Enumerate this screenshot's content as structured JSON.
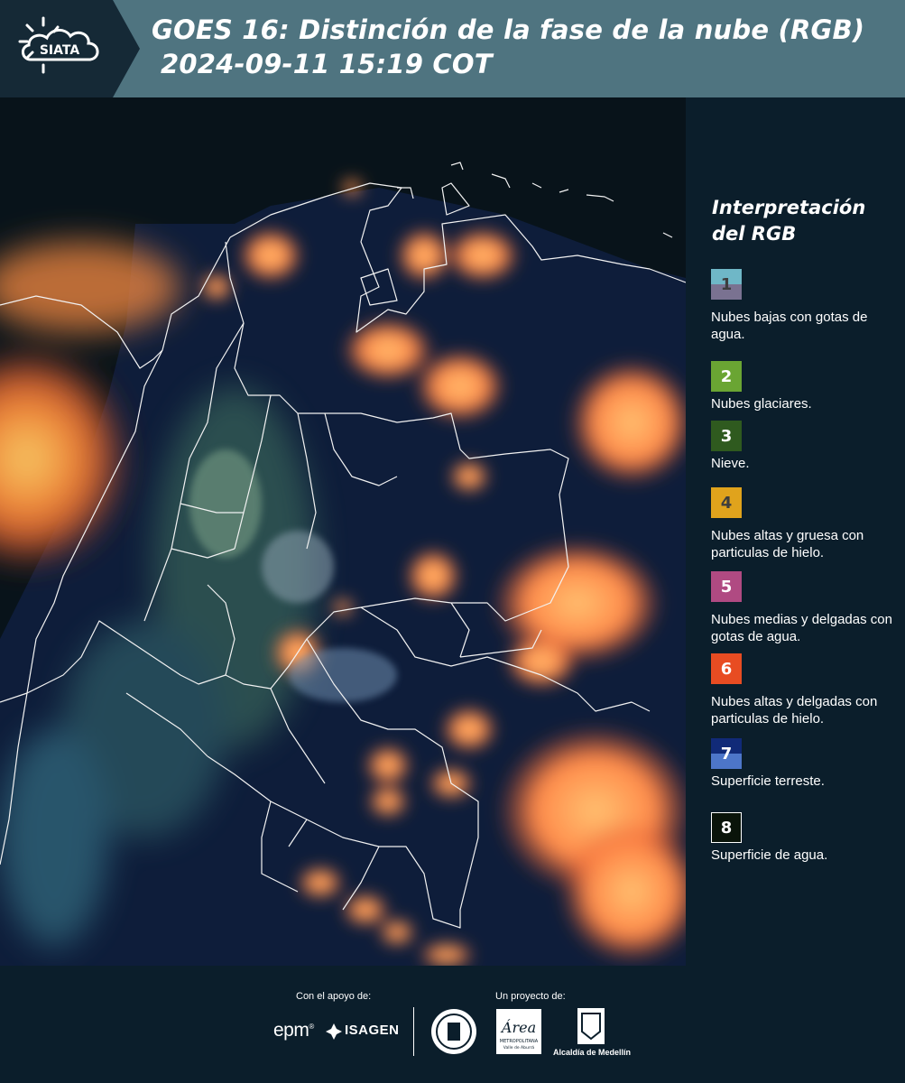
{
  "header": {
    "logo_text": "SIATA",
    "title_line1": "GOES 16: Distinción de la fase de la nube (RGB)",
    "title_line2": "2024-09-11 15:19 COT",
    "bg_color": "#4f7480"
  },
  "legend": {
    "title": "Interpretación del RGB",
    "items": [
      {
        "number": "1",
        "label": "Nubes bajas con gotas de agua.",
        "color_top": "#6fb7c7",
        "color_bottom": "#7a7291"
      },
      {
        "number": "2",
        "label": "Nubes glaciares.",
        "color": "#6aa533"
      },
      {
        "number": "3",
        "label": "Nieve.",
        "color": "#2f5a1f"
      },
      {
        "number": "4",
        "label": "Nubes altas y gruesa con particulas de hielo.",
        "color": "#e0a31c"
      },
      {
        "number": "5",
        "label": "Nubes medias y delgadas con gotas de agua.",
        "color": "#b04a82"
      },
      {
        "number": "6",
        "label": "Nubes altas y delgadas con particulas de hielo.",
        "color": "#e84c22"
      },
      {
        "number": "7",
        "label": "Superficie terreste.",
        "color_top": "#112a78",
        "color_bottom": "#4d76c9"
      },
      {
        "number": "8",
        "label": "Superficie de agua.",
        "color": "#0a140a",
        "border": "#ffffff"
      }
    ]
  },
  "footer": {
    "support_label": "Con el apoyo de:",
    "project_label": "Un proyecto de:",
    "sponsors": [
      "epm",
      "ISAGEN"
    ],
    "alcaldia": "Alcaldía de Medellín",
    "amva_name": "Área",
    "amva_sub1": "METROPOLITANA",
    "amva_sub2": "Valle de Aburrá"
  },
  "map": {
    "description_icon": "satellite-rgb-map"
  }
}
